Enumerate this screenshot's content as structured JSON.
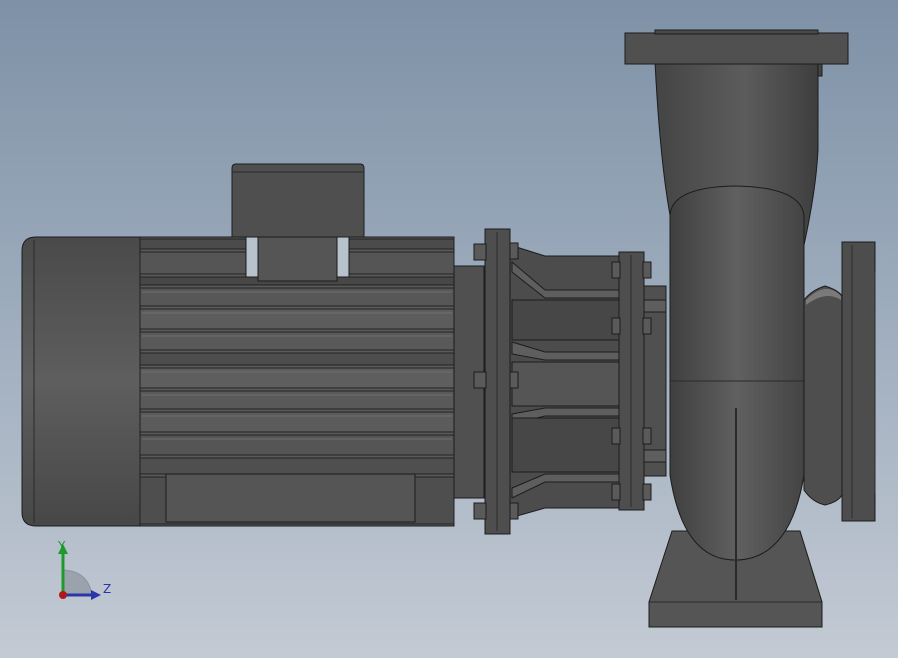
{
  "viewport": {
    "background_top": "#7e91a6",
    "background_bottom": "#c3cad4"
  },
  "model": {
    "part_color": "#555555",
    "part_dark": "#3a3a3a",
    "part_light": "#6a6a6a",
    "edge_color": "#1c1c1c"
  },
  "triad": {
    "y_label": "Y",
    "z_label": "Z",
    "y_color": "#1e9a2c",
    "z_color": "#2a35a8",
    "origin_color": "#b0161a"
  }
}
